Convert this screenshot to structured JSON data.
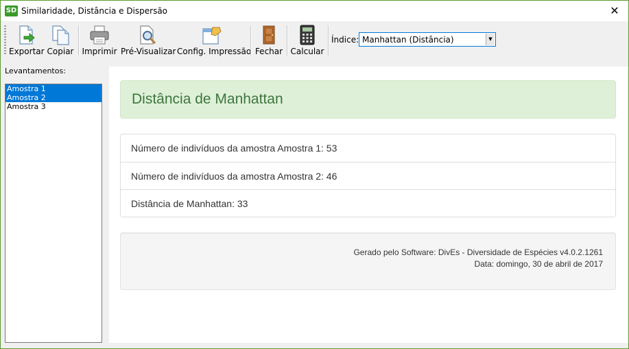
{
  "window": {
    "icon_text": "SD",
    "title": "Similaridade, Distância e Dispersão",
    "close_glyph": "✕"
  },
  "toolbar": {
    "buttons": [
      {
        "label": "Exportar",
        "icon": "export-icon"
      },
      {
        "label": "Copiar",
        "icon": "copy-icon"
      },
      {
        "label": "Imprimir",
        "icon": "printer-icon"
      },
      {
        "label": "Pré-Visualizar",
        "icon": "preview-icon"
      },
      {
        "label": "Config. Impressão",
        "icon": "print-settings-icon"
      },
      {
        "label": "Fechar",
        "icon": "door-icon"
      },
      {
        "label": "Calcular",
        "icon": "calculator-icon"
      }
    ],
    "indice_label": "Índice:",
    "indice_value": "Manhattan (Distância)"
  },
  "sidebar": {
    "label": "Levantamentos:",
    "items": [
      {
        "label": "Amostra 1",
        "selected": true
      },
      {
        "label": "Amostra 2",
        "selected": true
      },
      {
        "label": "Amostra 3",
        "selected": false
      }
    ]
  },
  "report": {
    "title": "Distância de Manhattan",
    "rows": [
      "Número de indivíduos da amostra Amostra 1: 53",
      "Número de indivíduos da amostra Amostra 2: 46",
      "Distância de Manhattan: 33"
    ],
    "footer": {
      "generated_by": "Gerado pelo Software: DivEs - Diversidade de Espécies v4.0.2.1261",
      "date": "Data: domingo, 30 de abril de 2017"
    }
  },
  "colors": {
    "selection": "#0078d7",
    "success_bg": "#dff0d8",
    "success_text": "#3c763d",
    "window_border": "#5a9a32"
  }
}
